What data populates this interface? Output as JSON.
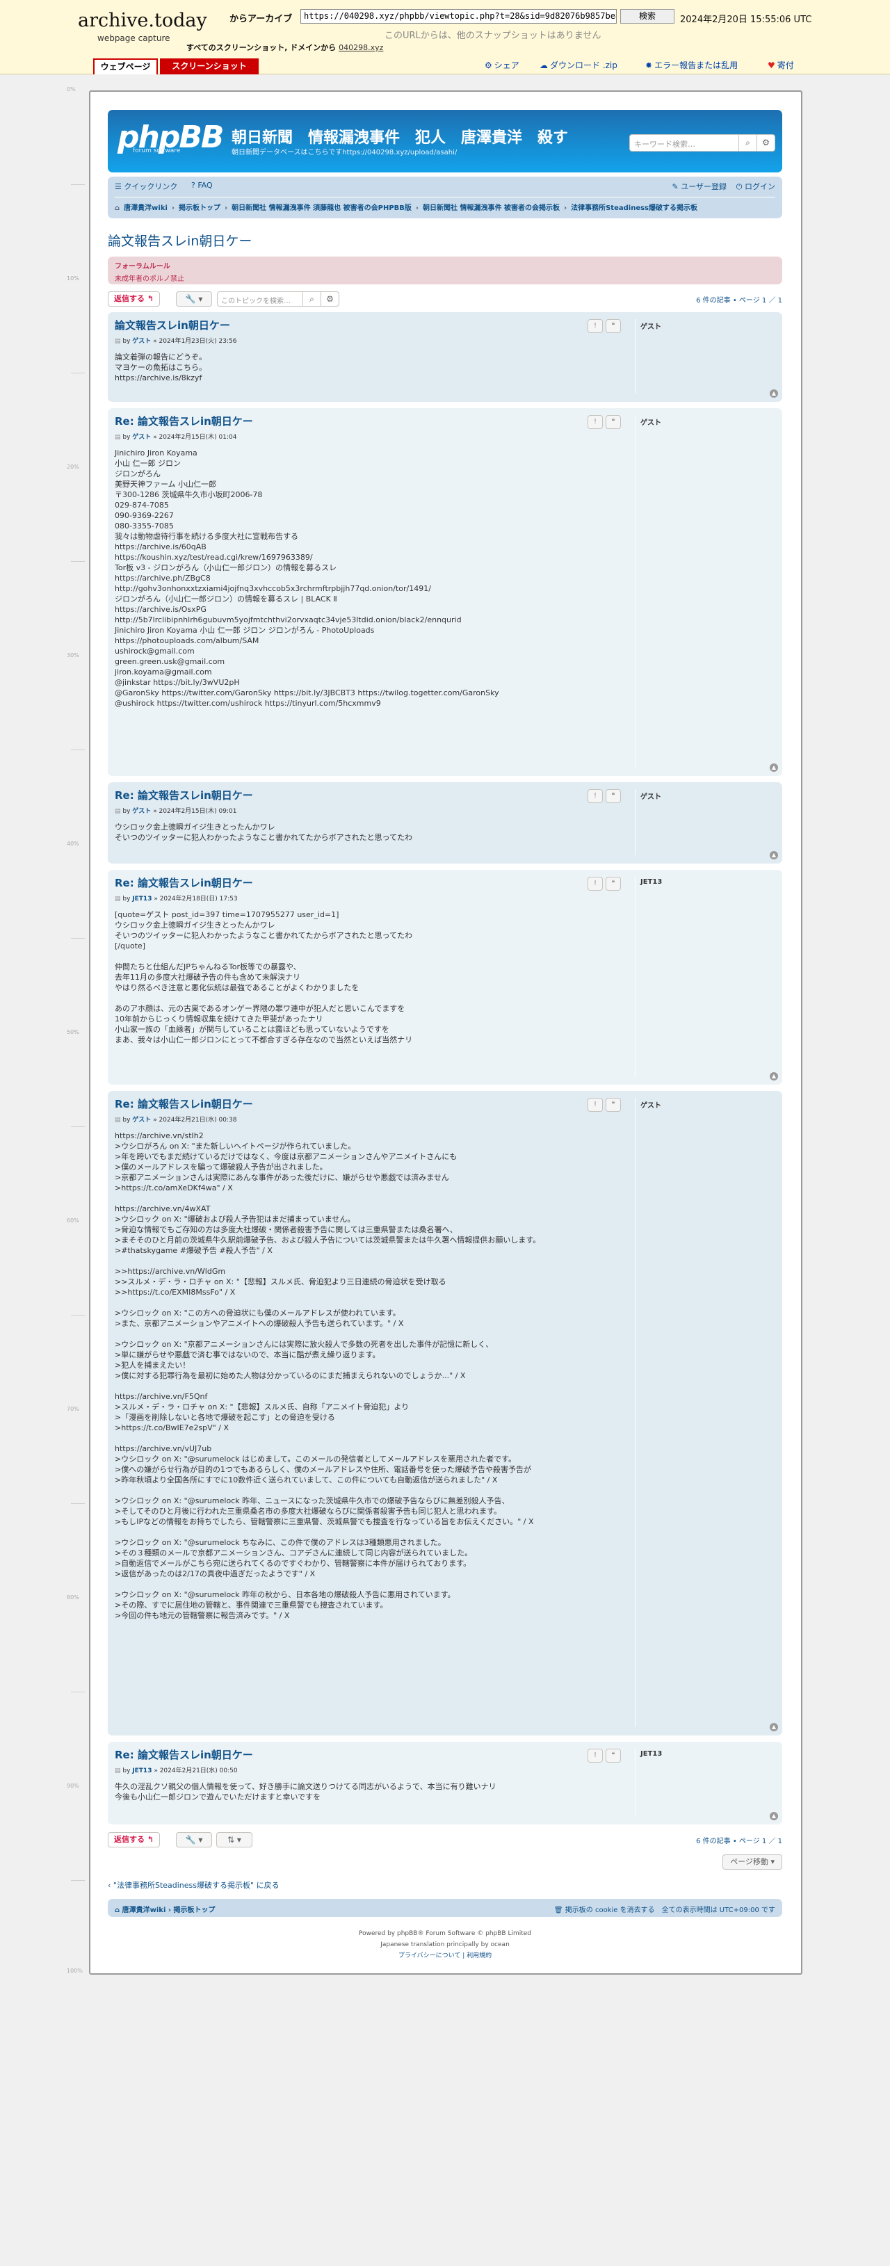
{
  "archive": {
    "logo": "archive.today",
    "subtitle": "webpage capture",
    "saved_from_label": "からアーカイブ",
    "url": "https://040298.xyz/phpbb/viewtopic.php?t=28&sid=9d82076b9857be8",
    "search_button": "検索",
    "date": "2024年2月20日 15:55:06 UTC",
    "no_other_snapshots": "このURLからは、他のスナップショットはありません",
    "all_snapshots_prefix": "すべてのスクリーンショット, ドメインから",
    "domain_link": "040298.xyz",
    "tab_webpage": "ウェブページ",
    "tab_screenshot": "スクリーンショット",
    "share": "シェア",
    "download": "ダウンロード .zip",
    "report": "エラー報告または乱用",
    "donate": "寄付"
  },
  "ruler": [
    "0%",
    "10%",
    "20%",
    "30%",
    "40%",
    "50%",
    "60%",
    "70%",
    "80%",
    "90%",
    "100%"
  ],
  "forum": {
    "logo": "phpBB",
    "logo_sub": "forum software",
    "site_name": "朝日新聞　情報漏洩事件　犯人　唐澤貴洋　殺す",
    "site_desc": "朝日新聞データベースはこちらですhttps://040298.xyz/upload/asahi/",
    "search_placeholder": "キーワード検索…",
    "quick_links": "クイックリンク",
    "faq": "FAQ",
    "register": "ユーザー登録",
    "login": "ログイン",
    "breadcrumbs": [
      "唐澤貴洋wiki",
      "掲示板トップ",
      "朝日新聞社 情報漏洩事件 須藤龍也 被害者の会PHPBB版",
      "朝日新聞社 情報漏洩事件 被害者の会掲示板",
      "法律事務所Steadiness爆破する掲示板"
    ],
    "topic_title": "論文報告スレin朝日ケー",
    "rules_title": "フォーラムルール",
    "rules_text": "未成年者のポルノ禁止",
    "reply_button": "返信する",
    "topic_search_placeholder": "このトピックを検索…",
    "pagination": "6 件の記事 • ページ 1 ／ 1",
    "jump_button": "ページ移動",
    "return_link": "\"法律事務所Steadiness爆破する掲示板\" に戻る",
    "footer_left": "唐澤貴洋wiki › 掲示板トップ",
    "footer_cookie": "掲示板の cookie を消去する",
    "footer_tz": "全ての表示時間は UTC+09:00 です",
    "powered": "Powered by phpBB® Forum Software © phpBB Limited",
    "translation": "Japanese translation principally by ocean",
    "privacy": "プライバシーについて | 利用規約"
  },
  "posts": [
    {
      "title": "論文報告スレin朝日ケー",
      "by": "by",
      "author": "ゲスト",
      "date": "» 2024年1月23日(火) 23:56",
      "username": "ゲスト",
      "body": "論文着弾の報告にどうぞ。\nマヨケーの魚拓はこちら。\nhttps://archive.is/8kzyf"
    },
    {
      "title": "Re: 論文報告スレin朝日ケー",
      "by": "by",
      "author": "ゲスト",
      "date": "» 2024年2月15日(木) 01:04",
      "username": "ゲスト",
      "body": "Jinichiro Jiron Koyama\n小山 仁一郎 ジロン\nジロンがろん\n美野天神ファーム 小山仁一郎\n〒300-1286 茨城県牛久市小坂町2006-78\n029-874-7085\n090-9369-2267\n080-3355-7085\n我々は動物虐待行事を続ける多度大社に宣戦布告する\nhttps://archive.is/60qAB\nhttps://koushin.xyz/test/read.cgi/krew/1697963389/\nTor板 v3 - ジロンがろん（小山仁一郎ジロン）の情報を募るスレ\nhttps://archive.ph/ZBgC8\nhttp://gohv3onhonxxtzxiami4jojfnq3xvhccob5x3rchrmftrpbjjh77qd.onion/tor/1491/\nジロンがろん（小山仁一郎ジロン）の情報を募るスレ | BLACK Ⅱ\nhttps://archive.is/OsxPG\nhttp://5b7lrclibipnhlrh6gubuvm5yojfmtchthvi2orvxaqtc34vje53ltdid.onion/black2/ennqurid\nJinichiro Jiron Koyama 小山 仁一郎 ジロン ジロンがろん - PhotoUploads\nhttps://photouploads.com/album/SAM\nushirock@gmail.com\ngreen.green.usk@gmail.com\njiron.koyama@gmail.com\n@jinkstar https://bit.ly/3wVU2pH\n@GaronSky https://twitter.com/GaronSky https://bit.ly/3JBCBT3 https://twilog.togetter.com/GaronSky\n@ushirock https://twitter.com/ushirock https://tinyurl.com/5hcxmmv9"
    },
    {
      "title": "Re: 論文報告スレin朝日ケー",
      "by": "by",
      "author": "ゲスト",
      "date": "» 2024年2月15日(木) 09:01",
      "username": "ゲスト",
      "body": "ウシロック金上徳瞬ガイジ生きとったんかワレ\nそいつのツイッターに犯人わかったようなこと書かれてたからボアされたと思ってたわ"
    },
    {
      "title": "Re: 論文報告スレin朝日ケー",
      "by": "by",
      "author": "JET13",
      "date": "» 2024年2月18日(日) 17:53",
      "username": "JET13",
      "body": "[quote=ゲスト post_id=397 time=1707955277 user_id=1]\nウシロック金上徳瞬ガイジ生きとったんかワレ\nそいつのツイッターに犯人わかったようなこと書かれてたからボアされたと思ってたわ\n[/quote]\n\n仲間たちと仕組んだJPちゃんねるTor板等での暴露や、\n去年11月の多度大社爆破予告の件も含めて未解決ナリ\nやはり然るべき注意と悪化伝統は最強であることがよくわかりましたを\n\nあのアホ顔は、元の古巣であるオンゲー界隈の罪ワ連中が犯人だと思いこんでますを\n10年前からじっくり情報収集を続けてきた甲斐があったナリ\n小山家一族の「血縁者」が関与していることは露ほども思っていないようですを\nまあ、我々は小山仁一郎ジロンにとって不都合すぎる存在なので当然といえば当然ナリ"
    },
    {
      "title": "Re: 論文報告スレin朝日ケー",
      "by": "by",
      "author": "ゲスト",
      "date": "» 2024年2月21日(水) 00:38",
      "username": "ゲスト",
      "body": "https://archive.vn/stIh2\n>ウシロがろん on X: \"また新しいヘイトページが作られていました。\n>年を跨いでもまだ続けているだけではなく、今度は京都アニメーションさんやアニメイトさんにも\n>僕のメールアドレスを騙って爆破殺人予告が出されました。\n>京都アニメーションさんは実際にあんな事件があった後だけに、嫌がらせや悪戯では済みません\n>https://t.co/amXeDKf4wa\" / X\n\nhttps://archive.vn/4wXAT\n>ウシロック on X: \"爆破および殺人予告犯はまだ捕まっていません。\n>脅迫な情報でもご存知の方は多度大社爆破・関係者殺害予告に関しては三重県警または桑名署へ、\n>まそそのひと月前の茨城県牛久駅前爆破予告、および殺人予告については茨城県警または牛久署へ情報提供お願いします。\n>#thatskygame #爆破予告 #殺人予告\" / X\n\n>>https://archive.vn/WldGm\n>>スルメ・デ・ラ・ロチャ on X: \"【悲報】スルメ氏、脅迫犯より三日連続の脅迫状を受け取る\n>>https://t.co/EXMI8MssFo\" / X\n\n>ウシロック on X: \"この方への脅迫状にも僕のメールアドレスが使われています。\n>また、京都アニメーションやアニメイトへの爆破殺人予告も送られています。\" / X\n\n>ウシロック on X: \"京都アニメーションさんには実際に放火殺人で多数の死者を出した事件が記憶に新しく、\n>単に嫌がらせや悪戯で済む事ではないので、本当に酷が煮え繰り返ります。\n>犯人を捕まえたい！\n>僕に対する犯罪行為を最初に始めた人物は分かっているのにまだ捕まえられないのでしょうか...\" / X\n\nhttps://archive.vn/F5Qnf\n>スルメ・デ・ラ・ロチャ on X: \"【悲報】スルメ氏、自称「アニメイト脅迫犯」より\n>「漫画を削除しないと各地で爆破を起こす」との脅迫を受ける\n>https://t.co/BwIE7e2spV\" / X\n\nhttps://archive.vn/vUJ7ub\n>ウシロック on X: \"@surumelock はじめまして。このメールの発信者としてメールアドレスを悪用された者です。\n>僕への嫌がらせ行為が目的の1つでもあるらしく、僕のメールアドレスや住所、電話番号を使った爆破予告や殺害予告が\n>昨年秋頃より全国各所にすでに10数件近く送られていまして、この件についても自動返信が送られました\" / X\n\n>ウシロック on X: \"@surumelock 昨年、ニュースになった茨城県牛久市での爆破予告ならびに無差別殺人予告、\n>そしてそのひと月後に行われた三重県桑名市の多度大社爆破ならびに関係者殺害予告も同じ犯人と思われます。\n>もしIPなどの情報をお持ちでしたら、管轄警察に三重県警、茨城県警でも捜査を行なっている旨をお伝えください。\" / X\n\n>ウシロック on X: \"@surumelock ちなみに、この件で僕のアドレスは3種類悪用されました。\n>その３種類のメールで京都アニメーションさん、コアデさんに連続して同じ内容が送られていました。\n>自動返信でメールがこちら宛に送られてくるのですぐわかり、管轄警察に本件が届けられております。\n>返信があったのは2/17の真夜中過ぎだったようです\" / X\n\n>ウシロック on X: \"@surumelock 昨年の秋から、日本各地の爆破殺人予告に悪用されています。\n>その際、すでに居住地の管轄と、事件関連で三重県警でも捜査されています。\n>今回の件も地元の管轄警察に報告済みです。\" / X"
    },
    {
      "title": "Re: 論文報告スレin朝日ケー",
      "by": "by",
      "author": "JET13",
      "date": "» 2024年2月21日(水) 00:50",
      "username": "JET13",
      "body": "牛久の淫乱クソ親父の個人情報を使って、好き勝手に論文送りつけてる同志がいるようで、本当に有り難いナリ\n今後も小山仁一郎ジロンで遊んでいただけますと幸いですを"
    }
  ]
}
